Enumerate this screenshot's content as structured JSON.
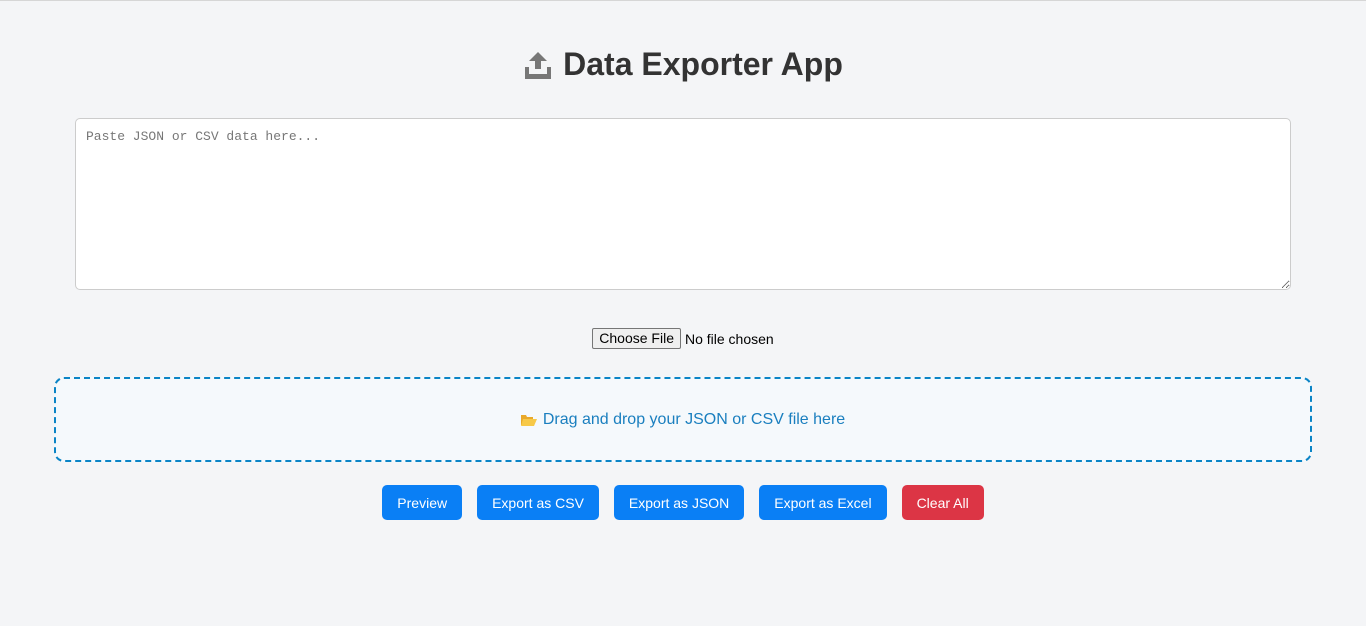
{
  "header": {
    "title": "Data Exporter App",
    "icon": "upload-tray-icon"
  },
  "input": {
    "placeholder": "Paste JSON or CSV data here...",
    "value": ""
  },
  "file_picker": {
    "button_label": "Choose File",
    "status_text": "No file chosen"
  },
  "drop_zone": {
    "icon": "open-folder-icon",
    "text": "Drag and drop your JSON or CSV file here"
  },
  "actions": {
    "preview": "Preview",
    "export_csv": "Export as CSV",
    "export_json": "Export as JSON",
    "export_excel": "Export as Excel",
    "clear_all": "Clear All"
  },
  "colors": {
    "background": "#f4f5f7",
    "primary_button": "#0a7ff5",
    "danger_button": "#dc3545",
    "drop_zone_border": "#0a84c6",
    "drop_zone_text": "#1a7fbf",
    "title_text": "#333333"
  }
}
